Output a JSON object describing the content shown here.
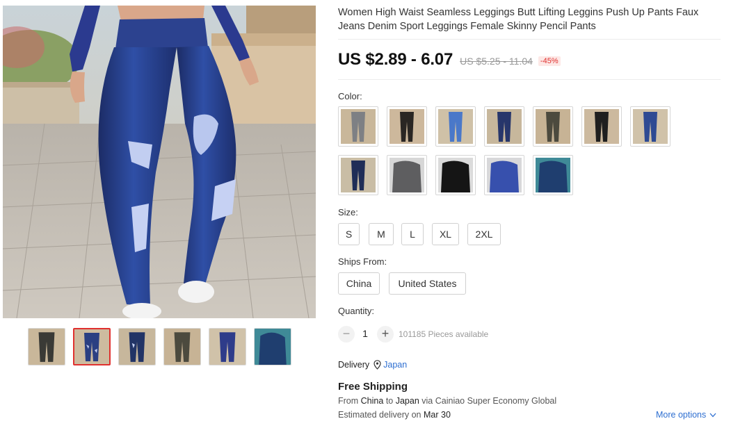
{
  "product": {
    "title": "Women High Waist Seamless Leggings Butt Lifting Leggins Push Up Pants Faux Jeans Denim Sport Leggings Female Skinny Pencil Pants"
  },
  "price": {
    "current": "US $2.89 - 6.07",
    "original": "US $5.25 - 11.04",
    "discount": "-45%"
  },
  "color": {
    "label": "Color:",
    "options": [
      {
        "name": "grey-camo",
        "pant": "#7e8084",
        "bg": "#c9b79a"
      },
      {
        "name": "black-ripped",
        "pant": "#2a2623",
        "bg": "#cdb89c"
      },
      {
        "name": "light-blue",
        "pant": "#4a78c9",
        "bg": "#cfc1a7"
      },
      {
        "name": "dark-denim",
        "pant": "#27366b",
        "bg": "#c7b79c"
      },
      {
        "name": "olive",
        "pant": "#4c4a3e",
        "bg": "#c7b395"
      },
      {
        "name": "black",
        "pant": "#1f1f1f",
        "bg": "#ccb99e"
      },
      {
        "name": "blue-jeans",
        "pant": "#2e4a93",
        "bg": "#d0c2a9"
      },
      {
        "name": "navy-ripped",
        "pant": "#1f2d57",
        "bg": "#c9bda5"
      },
      {
        "name": "grey-tight",
        "pant": "#5e5e60",
        "bg": "#d7d7d7"
      },
      {
        "name": "black-tight",
        "pant": "#151515",
        "bg": "#dbdbdb"
      },
      {
        "name": "royal-blue",
        "pant": "#3750ad",
        "bg": "#d8d8da"
      },
      {
        "name": "deep-blue",
        "pant": "#1f3e6f",
        "bg": "#3f8a97"
      }
    ]
  },
  "size": {
    "label": "Size:",
    "options": [
      "S",
      "M",
      "L",
      "XL",
      "2XL"
    ]
  },
  "ships_from": {
    "label": "Ships From:",
    "options": [
      "China",
      "United States"
    ]
  },
  "quantity": {
    "label": "Quantity:",
    "minus": "−",
    "plus": "+",
    "value": "1",
    "available": "101185 Pieces available"
  },
  "delivery": {
    "label": "Delivery",
    "country": "Japan"
  },
  "shipping": {
    "title": "Free Shipping",
    "from_prefix": "From",
    "from": "China",
    "to_word": "to",
    "to": "Japan",
    "via": "via Cainiao Super Economy Global",
    "eta_prefix": "Estimated delivery on",
    "eta_date": "Mar 30",
    "more_options": "More options"
  },
  "gallery": {
    "thumbnails": [
      {
        "pant": "#3a3a36",
        "bg": "#c9b79a"
      },
      {
        "pant": "#2b3f82",
        "bg": "#cdbb9f"
      },
      {
        "pant": "#223466",
        "bg": "#c7b79c"
      },
      {
        "pant": "#4c4a3e",
        "bg": "#c7b395"
      },
      {
        "pant": "#2e3c8a",
        "bg": "#d0c2a9"
      },
      {
        "pant": "#1f3e6f",
        "bg": "#3f8a97"
      }
    ],
    "active_index": 1
  },
  "colors": {
    "accent_red": "#e0302e",
    "link_blue": "#2e6fd1",
    "denim": "#27408c"
  }
}
